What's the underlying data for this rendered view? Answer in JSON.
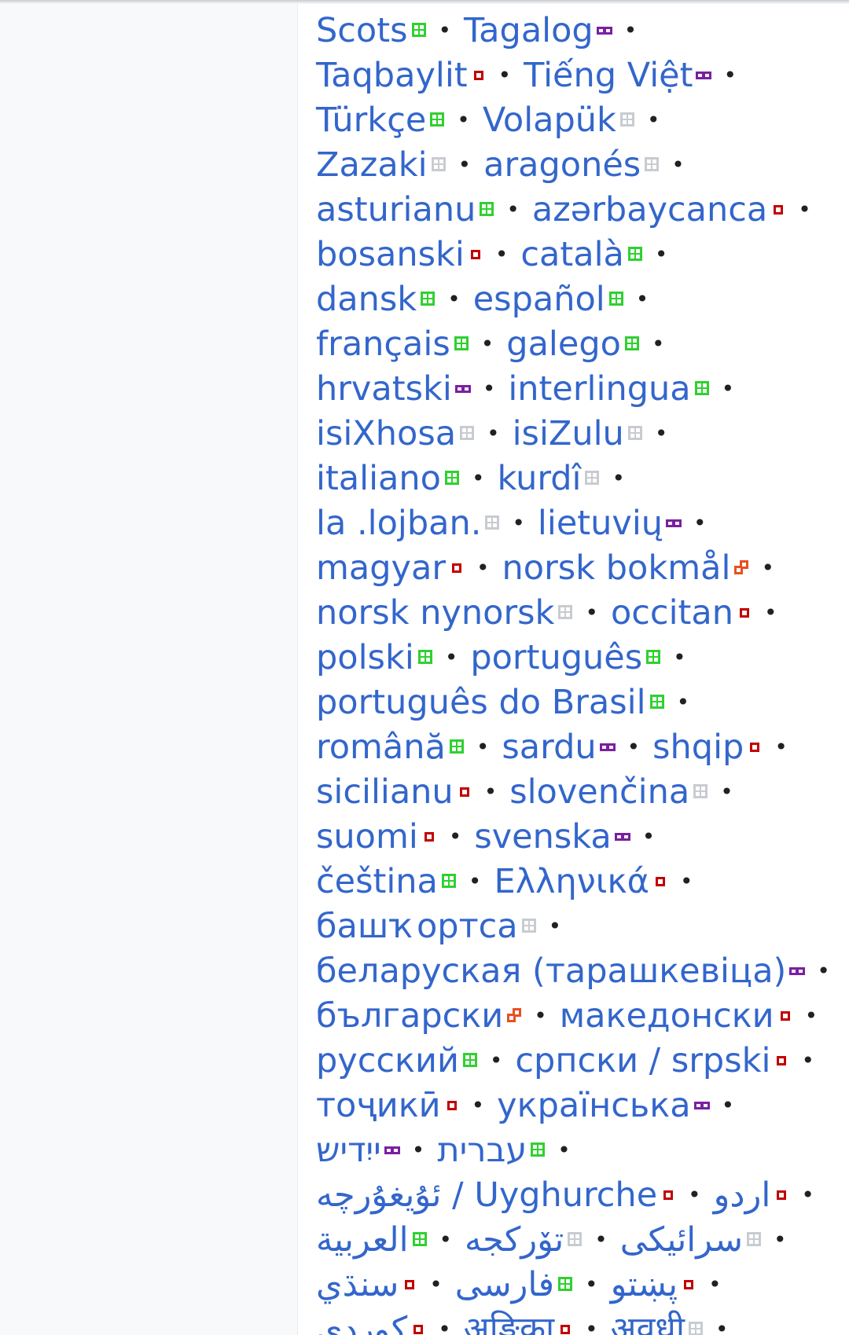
{
  "badge_colors": {
    "green": "#2fd12f",
    "red": "#c20000",
    "purple": "#7b1fa2",
    "gray": "#c8ccd1",
    "orange": "#e8501f"
  },
  "badge_icons": {
    "green": "featured-complete-icon",
    "red": "incomplete-icon",
    "purple": "partial-icon",
    "gray": "empty-icon",
    "orange": "progress-icon"
  },
  "languages": [
    [
      {
        "name": "Scots",
        "badge": "green"
      },
      {
        "name": "Tagalog",
        "badge": "purple"
      }
    ],
    [
      {
        "name": "Taqbaylit",
        "badge": "red"
      },
      {
        "name": "Tiếng Việt",
        "badge": "purple"
      }
    ],
    [
      {
        "name": "Türkçe",
        "badge": "green"
      },
      {
        "name": "Volapük",
        "badge": "gray"
      }
    ],
    [
      {
        "name": "Zazaki",
        "badge": "gray"
      },
      {
        "name": "aragonés",
        "badge": "gray"
      }
    ],
    [
      {
        "name": "asturianu",
        "badge": "green"
      },
      {
        "name": "azərbaycanca",
        "badge": "red"
      }
    ],
    [
      {
        "name": "bosanski",
        "badge": "red"
      },
      {
        "name": "català",
        "badge": "green"
      }
    ],
    [
      {
        "name": "dansk",
        "badge": "green"
      },
      {
        "name": "español",
        "badge": "green"
      }
    ],
    [
      {
        "name": "français",
        "badge": "green"
      },
      {
        "name": "galego",
        "badge": "green"
      }
    ],
    [
      {
        "name": "hrvatski",
        "badge": "purple"
      },
      {
        "name": "interlingua",
        "badge": "green"
      }
    ],
    [
      {
        "name": "isiXhosa",
        "badge": "gray"
      },
      {
        "name": "isiZulu",
        "badge": "gray"
      }
    ],
    [
      {
        "name": "italiano",
        "badge": "green"
      },
      {
        "name": "kurdî",
        "badge": "gray"
      }
    ],
    [
      {
        "name": "la .lojban.",
        "badge": "gray"
      },
      {
        "name": "lietuvių",
        "badge": "purple"
      }
    ],
    [
      {
        "name": "magyar",
        "badge": "red"
      },
      {
        "name": "norsk bokmål",
        "badge": "orange"
      }
    ],
    [
      {
        "name": "norsk nynorsk",
        "badge": "gray"
      },
      {
        "name": "occitan",
        "badge": "red"
      }
    ],
    [
      {
        "name": "polski",
        "badge": "green"
      },
      {
        "name": "português",
        "badge": "green"
      }
    ],
    [
      {
        "name": "português do Brasil",
        "badge": "green"
      }
    ],
    [
      {
        "name": "română",
        "badge": "green"
      },
      {
        "name": "sardu",
        "badge": "purple"
      },
      {
        "name": "shqip",
        "badge": "red"
      }
    ],
    [
      {
        "name": "sicilianu",
        "badge": "red"
      },
      {
        "name": "slovenčina",
        "badge": "gray"
      }
    ],
    [
      {
        "name": "suomi",
        "badge": "red"
      },
      {
        "name": "svenska",
        "badge": "purple"
      }
    ],
    [
      {
        "name": "čeština",
        "badge": "green"
      },
      {
        "name": "Ελληνικά",
        "badge": "red"
      }
    ],
    [
      {
        "name": "башҡортса",
        "badge": "gray"
      }
    ],
    [
      {
        "name": "беларуская (тарашкевіца)",
        "badge": "purple"
      }
    ],
    [
      {
        "name": "български",
        "badge": "orange"
      },
      {
        "name": "македонски",
        "badge": "red"
      }
    ],
    [
      {
        "name": "русский",
        "badge": "green"
      },
      {
        "name": "српски / srpski",
        "badge": "red"
      }
    ],
    [
      {
        "name": "тоҷикӣ",
        "badge": "red"
      },
      {
        "name": "українська",
        "badge": "purple"
      }
    ],
    [
      {
        "name": "ייִדיש",
        "badge": "purple",
        "rtl": true
      },
      {
        "name": "עברית",
        "badge": "green",
        "rtl": true
      }
    ],
    [
      {
        "name": "ئۇيغۇرچە / Uyghurche",
        "badge": "red"
      },
      {
        "name": "اردو",
        "badge": "red",
        "rtl": true
      }
    ],
    [
      {
        "name": "العربية",
        "badge": "green",
        "rtl": true
      },
      {
        "name": "تۆرکجه",
        "badge": "gray",
        "rtl": true
      },
      {
        "name": "سرائیکی",
        "badge": "gray",
        "rtl": true
      }
    ],
    [
      {
        "name": "سنڌي",
        "badge": "red",
        "rtl": true
      },
      {
        "name": "فارسی",
        "badge": "green",
        "rtl": true
      },
      {
        "name": "پښتو",
        "badge": "red",
        "rtl": true
      }
    ],
    [
      {
        "name": "کوردی",
        "badge": "red",
        "rtl": true
      },
      {
        "name": "अङ्गिका",
        "badge": "red"
      },
      {
        "name": "अवधी",
        "badge": "gray"
      }
    ]
  ],
  "separator": "•"
}
